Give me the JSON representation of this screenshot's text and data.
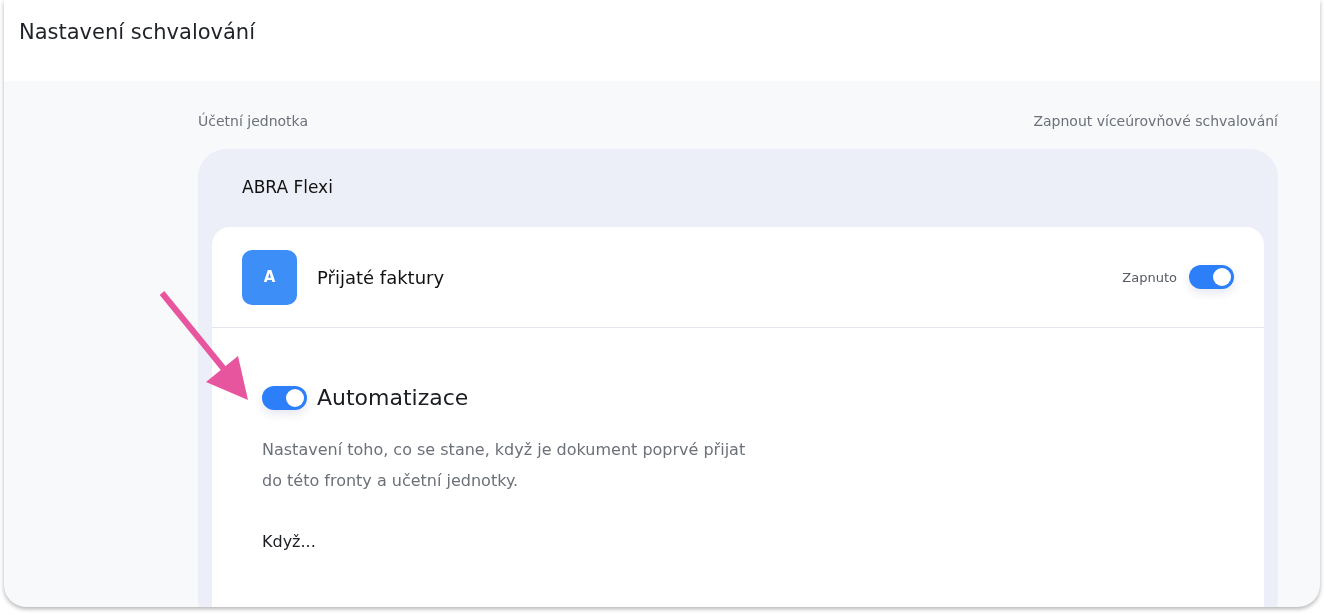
{
  "window": {
    "title": "Nastavení schvalování"
  },
  "columns": {
    "left": "Účetní jednotka",
    "right": "Zapnout víceúrovňové schvalování"
  },
  "unit": {
    "name": "ABRA Flexi",
    "queue": {
      "avatar": "A",
      "name": "Přijaté faktury",
      "status_label": "Zapnuto",
      "on": true
    },
    "automation": {
      "title": "Automatizace",
      "on": true,
      "description": "Nastavení toho, co se stane, když je dokument poprvé přijat do této fronty a učetní jednotky.",
      "condition_label": "Když..."
    }
  }
}
